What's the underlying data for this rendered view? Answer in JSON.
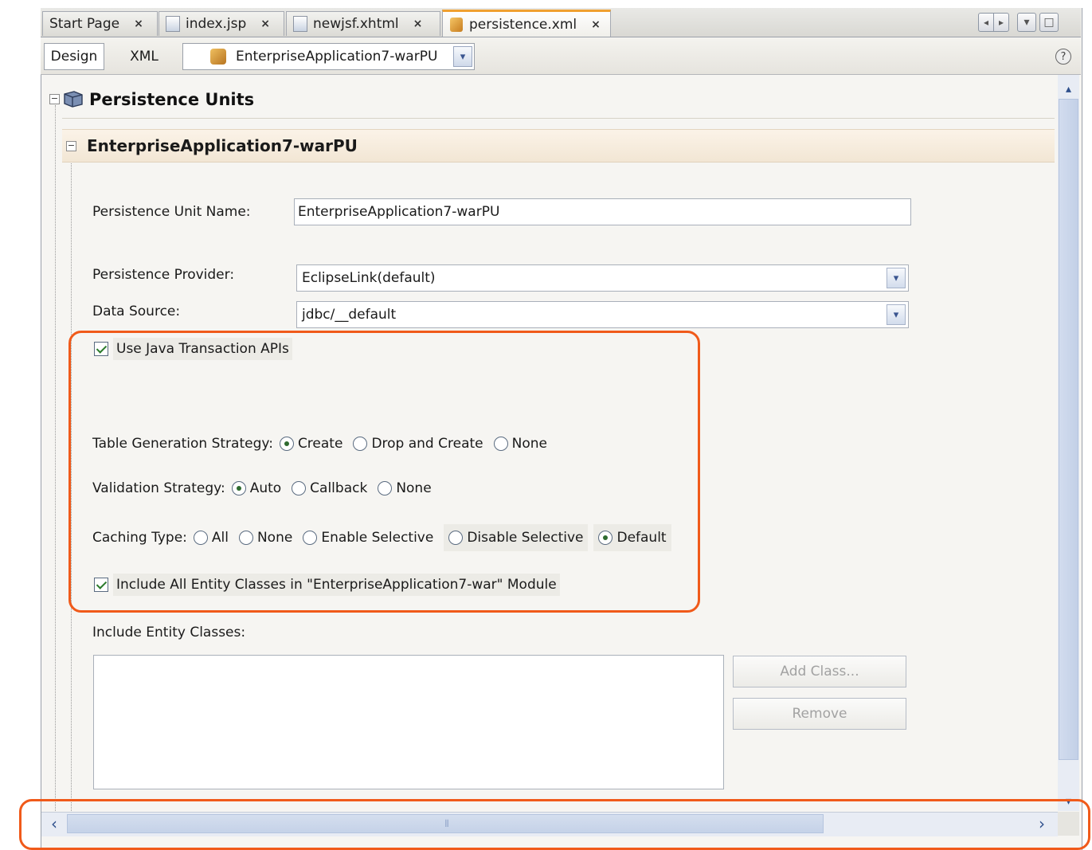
{
  "tabs": [
    {
      "label": "Start Page",
      "icon": "none"
    },
    {
      "label": "index.jsp",
      "icon": "jsp-file-icon"
    },
    {
      "label": "newjsf.xhtml",
      "icon": "xhtml-file-icon"
    },
    {
      "label": "persistence.xml",
      "icon": "xml-file-icon",
      "active": true
    }
  ],
  "tab_close_glyph": "×",
  "tab_nav": {
    "left": "◂",
    "right": "▸",
    "dropdown": "▾",
    "maximize": "□"
  },
  "toolbar": {
    "design_label": "Design",
    "xml_label": "XML",
    "selected_unit": "EnterpriseApplication7-warPU",
    "dropdown_glyph": "▾",
    "help_glyph": "?"
  },
  "tree": {
    "expand_glyph": "−"
  },
  "section_title": "Persistence Units",
  "unit": {
    "header": "EnterpriseApplication7-warPU",
    "name_label": "Persistence Unit Name:",
    "name_value": "EnterpriseApplication7-warPU",
    "provider_label": "Persistence Provider:",
    "provider_value": "EclipseLink(default)",
    "datasource_label": "Data Source:",
    "datasource_value": "jdbc/__default",
    "jta_label": "Use Java Transaction APIs",
    "jta_checked": true,
    "table_gen": {
      "label": "Table Generation Strategy:",
      "options": [
        "Create",
        "Drop and Create",
        "None"
      ],
      "selected": "Create"
    },
    "validation": {
      "label": "Validation Strategy:",
      "options": [
        "Auto",
        "Callback",
        "None"
      ],
      "selected": "Auto"
    },
    "caching": {
      "label": "Caching Type:",
      "options": [
        "All",
        "None",
        "Enable Selective",
        "Disable Selective",
        "Default"
      ],
      "selected": "Default"
    },
    "include_all_label": "Include All Entity Classes in \"EnterpriseApplication7-war\" Module",
    "include_all_checked": true,
    "include_entities_label": "Include Entity Classes:",
    "add_class_label": "Add Class...",
    "remove_label": "Remove"
  },
  "scroll": {
    "up": "▴",
    "down": "▾",
    "left": "‹",
    "right": "›",
    "grip": "⦀"
  },
  "colors": {
    "annotation": "#f05a1a",
    "active_tab_accent": "#f0a030",
    "header_bg": "#f2e6d4"
  }
}
